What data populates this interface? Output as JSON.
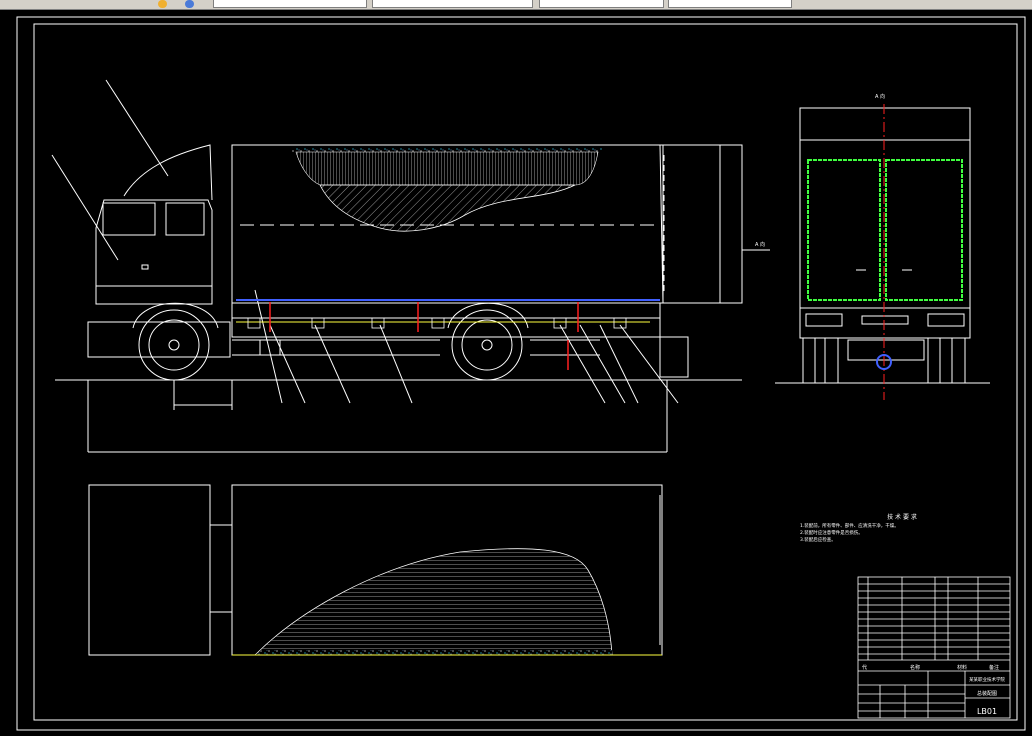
{
  "toolbar": {
    "fields": [
      "",
      "",
      "",
      "",
      ""
    ]
  },
  "drawing": {
    "view_label": "A 向",
    "view_mark": "A 向",
    "tech_title": "技 术 要 求",
    "tech_notes": [
      "1.装配前，所有零件、部件、应清洗干净，干燥。",
      "2.装配时应注意零件是否损伤。",
      "3.装配后应检查。"
    ],
    "title_block": {
      "school": "某某职业技术学院",
      "drawing_name": "总装配图",
      "drawing_no": "LB01",
      "header_seq": "代",
      "header_name": "名称",
      "header_material": "材料",
      "header_note": "备注"
    }
  },
  "colors": {
    "line": "#ffffff",
    "accent_red": "#ff2020",
    "accent_cyan": "#40e0ff",
    "accent_green": "#40ff40",
    "accent_yellow": "#ffff40",
    "accent_blue": "#4060ff"
  }
}
